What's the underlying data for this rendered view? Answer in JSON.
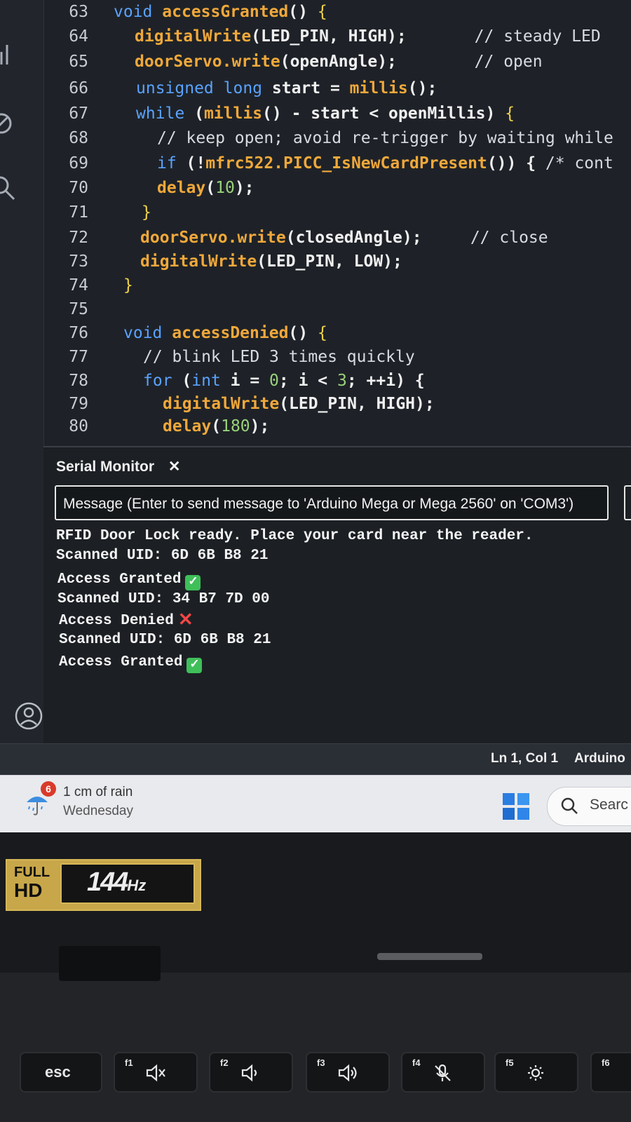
{
  "editor": {
    "lines": [
      {
        "n": "63",
        "indent": 0,
        "tokens": [
          [
            "kw",
            "void "
          ],
          [
            "fn",
            "accessGranted"
          ],
          [
            "pl",
            "() "
          ],
          [
            "brace",
            "{"
          ]
        ]
      },
      {
        "n": "64",
        "indent": 1,
        "tokens": [
          [
            "fn",
            "digitalWrite"
          ],
          [
            "pl",
            "(LED_PIN, HIGH);"
          ],
          [
            "cm",
            "       // steady LED"
          ]
        ]
      },
      {
        "n": "65",
        "indent": 1,
        "tokens": [
          [
            "fn",
            "doorServo.write"
          ],
          [
            "pl",
            "(openAngle);"
          ],
          [
            "cm",
            "        // open"
          ]
        ]
      },
      {
        "n": "66",
        "indent": 1,
        "tokens": [
          [
            "kw",
            "unsigned long "
          ],
          [
            "pl",
            "start = "
          ],
          [
            "fn",
            "millis"
          ],
          [
            "pl",
            "();"
          ]
        ]
      },
      {
        "n": "67",
        "indent": 1,
        "tokens": [
          [
            "kw",
            "while "
          ],
          [
            "pl",
            "("
          ],
          [
            "fn",
            "millis"
          ],
          [
            "pl",
            "() - start < openMillis) "
          ],
          [
            "brace",
            "{"
          ]
        ]
      },
      {
        "n": "68",
        "indent": 2,
        "tokens": [
          [
            "cm",
            "// keep open; avoid re-trigger by waiting while"
          ]
        ]
      },
      {
        "n": "69",
        "indent": 2,
        "tokens": [
          [
            "kw",
            "if "
          ],
          [
            "pl",
            "(!"
          ],
          [
            "fn",
            "mfrc522.PICC_IsNewCardPresent"
          ],
          [
            "pl",
            "()) { "
          ],
          [
            "cm",
            "/* cont"
          ]
        ]
      },
      {
        "n": "70",
        "indent": 2,
        "tokens": [
          [
            "fn",
            "delay"
          ],
          [
            "pl",
            "("
          ],
          [
            "num",
            "10"
          ],
          [
            "pl",
            ");"
          ]
        ]
      },
      {
        "n": "71",
        "indent": 1,
        "tokens": [
          [
            "brace",
            "}"
          ]
        ]
      },
      {
        "n": "72",
        "indent": 1,
        "tokens": [
          [
            "fn",
            "doorServo.write"
          ],
          [
            "pl",
            "(closedAngle);"
          ],
          [
            "cm",
            "     // close"
          ]
        ]
      },
      {
        "n": "73",
        "indent": 1,
        "tokens": [
          [
            "fn",
            "digitalWrite"
          ],
          [
            "pl",
            "(LED_PIN, LOW);"
          ]
        ]
      },
      {
        "n": "74",
        "indent": 0,
        "tokens": [
          [
            "brace",
            "}"
          ]
        ]
      },
      {
        "n": "75",
        "indent": 0,
        "tokens": []
      },
      {
        "n": "76",
        "indent": 0,
        "tokens": [
          [
            "kw",
            "void "
          ],
          [
            "fn",
            "accessDenied"
          ],
          [
            "pl",
            "() "
          ],
          [
            "brace",
            "{"
          ]
        ]
      },
      {
        "n": "77",
        "indent": 1,
        "tokens": [
          [
            "cm",
            "// blink LED 3 times quickly"
          ]
        ]
      },
      {
        "n": "78",
        "indent": 1,
        "tokens": [
          [
            "kw",
            "for "
          ],
          [
            "pl",
            "("
          ],
          [
            "kw",
            "int "
          ],
          [
            "pl",
            "i = "
          ],
          [
            "num",
            "0"
          ],
          [
            "pl",
            "; i < "
          ],
          [
            "num",
            "3"
          ],
          [
            "pl",
            "; ++i) {"
          ]
        ]
      },
      {
        "n": "79",
        "indent": 2,
        "tokens": [
          [
            "fn",
            "digitalWrite"
          ],
          [
            "pl",
            "(LED_PIN, HIGH);"
          ]
        ]
      },
      {
        "n": "80",
        "indent": 2,
        "tokens": [
          [
            "fn",
            "delay"
          ],
          [
            "pl",
            "("
          ],
          [
            "num",
            "180"
          ],
          [
            "pl",
            ");"
          ]
        ]
      }
    ]
  },
  "serial_monitor": {
    "tab_label": "Serial Monitor",
    "close_glyph": "✕",
    "input_placeholder": "Message (Enter to send message to 'Arduino Mega or Mega 2560' on 'COM3')",
    "output": [
      {
        "text": "RFID Door Lock ready. Place your card near the reader.",
        "emoji": ""
      },
      {
        "text": "Scanned UID: 6D 6B B8 21",
        "emoji": ""
      },
      {
        "text": "Access Granted",
        "emoji": "ok"
      },
      {
        "text": "Scanned UID: 34 B7 7D 00",
        "emoji": ""
      },
      {
        "text": "Access Denied",
        "emoji": "no"
      },
      {
        "text": "Scanned UID: 6D 6B B8 21",
        "emoji": ""
      },
      {
        "text": "Access Granted",
        "emoji": "ok"
      }
    ],
    "emoji_ok_glyph": "✓",
    "emoji_no_glyph": "✕"
  },
  "status_bar": {
    "position": "Ln 1, Col 1",
    "language": "Arduino"
  },
  "taskbar": {
    "weather_badge": "6",
    "weather_temp": "1 cm of rain",
    "weather_day": "Wednesday",
    "search_label": "Searc"
  },
  "bezel": {
    "badge_line1": "FULL",
    "badge_line2": "HD",
    "hz_value": "144",
    "hz_unit": "Hz"
  },
  "keyboard": {
    "esc": "esc",
    "keys": [
      {
        "fn": "f1",
        "icon": "mute-icon"
      },
      {
        "fn": "f2",
        "icon": "volume-down-icon"
      },
      {
        "fn": "f3",
        "icon": "volume-up-icon"
      },
      {
        "fn": "f4",
        "icon": "mic-mute-icon"
      },
      {
        "fn": "f5",
        "icon": "brightness-icon"
      },
      {
        "fn": "f6",
        "icon": ""
      }
    ]
  },
  "colors": {
    "editor_bg": "#1e2228",
    "keyword": "#5aa2ff",
    "function": "#f0a83a",
    "granted_green": "#3fbf5a",
    "denied_red": "#f04646",
    "bezel_gold": "#c8a74a"
  }
}
